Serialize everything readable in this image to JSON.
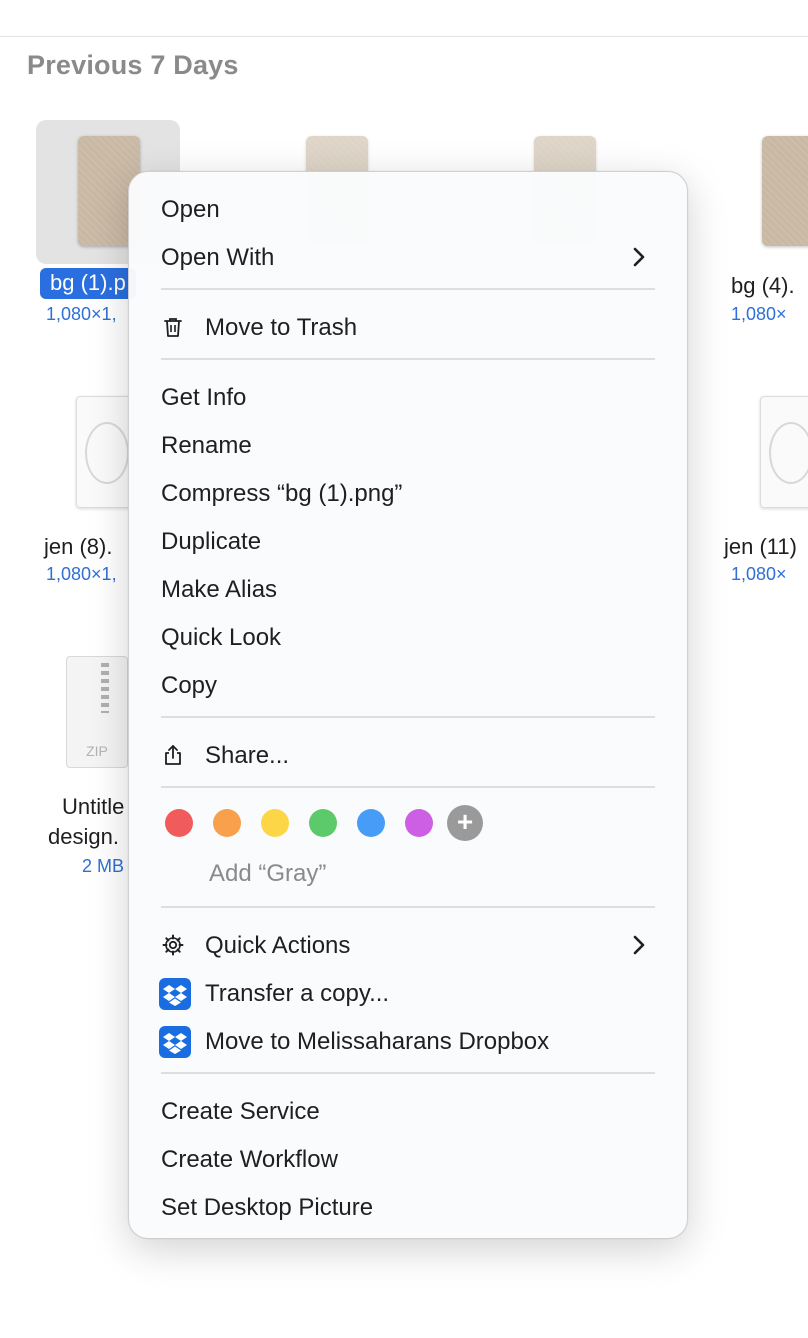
{
  "section": {
    "title": "Previous 7 Days"
  },
  "files": [
    {
      "name": "bg (1).p",
      "meta": "1,080×1,"
    },
    {
      "name": "bg (4).",
      "meta": "1,080×"
    },
    {
      "name": "jen (8).",
      "meta": "1,080×1,"
    },
    {
      "name": "jen (11)",
      "meta": "1,080×"
    },
    {
      "name_line1": "Untitle",
      "name_line2": "design.",
      "meta": "2 MB",
      "zip_label": "ZIP"
    }
  ],
  "menu": {
    "open": "Open",
    "open_with": "Open With",
    "move_to_trash": "Move to Trash",
    "get_info": "Get Info",
    "rename": "Rename",
    "compress": "Compress “bg (1).png”",
    "duplicate": "Duplicate",
    "make_alias": "Make Alias",
    "quick_look": "Quick Look",
    "copy": "Copy",
    "share": "Share...",
    "tags": [
      {
        "name": "red",
        "color": "#f25b5b"
      },
      {
        "name": "orange",
        "color": "#f8a04b"
      },
      {
        "name": "yellow",
        "color": "#fcd646"
      },
      {
        "name": "green",
        "color": "#5cc96b"
      },
      {
        "name": "blue",
        "color": "#479cf7"
      },
      {
        "name": "purple",
        "color": "#cc5fe3"
      }
    ],
    "add_tag": "Add “Gray”",
    "quick_actions": "Quick Actions",
    "transfer_copy": "Transfer a copy...",
    "move_to_dropbox": "Move to Melissaharans Dropbox",
    "create_service": "Create Service",
    "create_workflow": "Create Workflow",
    "set_desktop_picture": "Set Desktop Picture"
  }
}
